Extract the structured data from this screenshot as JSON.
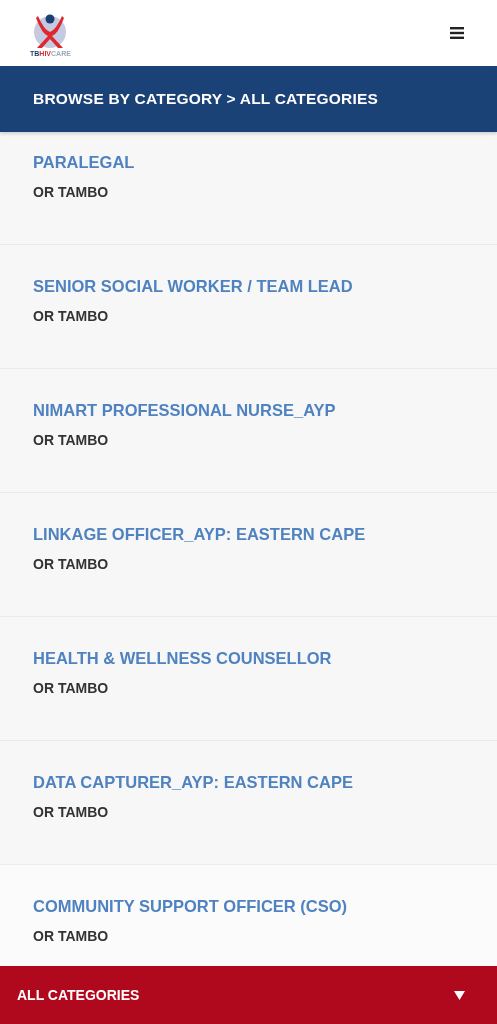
{
  "header": {
    "logo": {
      "parts": [
        {
          "text": "TB",
          "color": "#1b3f73"
        },
        {
          "text": "HIV",
          "color": "#d9262e"
        },
        {
          "text": "CARE",
          "color": "#9aa6bf"
        }
      ]
    }
  },
  "breadcrumb": "BROWSE BY CATEGORY > ALL CATEGORIES",
  "jobs": [
    {
      "title": "PARALEGAL",
      "location": "OR TAMBO"
    },
    {
      "title": "SENIOR SOCIAL WORKER / TEAM LEAD",
      "location": "OR TAMBO"
    },
    {
      "title": "NIMART PROFESSIONAL NURSE_AYP",
      "location": "OR TAMBO"
    },
    {
      "title": "LINKAGE OFFICER_AYP: EASTERN CAPE",
      "location": "OR TAMBO"
    },
    {
      "title": "HEALTH & WELLNESS COUNSELLOR",
      "location": "OR TAMBO"
    },
    {
      "title": "DATA CAPTURER_AYP: EASTERN CAPE",
      "location": "OR TAMBO"
    },
    {
      "title": "COMMUNITY SUPPORT OFFICER (CSO)",
      "location": "OR TAMBO"
    }
  ],
  "footer": {
    "label": "ALL CATEGORIES"
  }
}
